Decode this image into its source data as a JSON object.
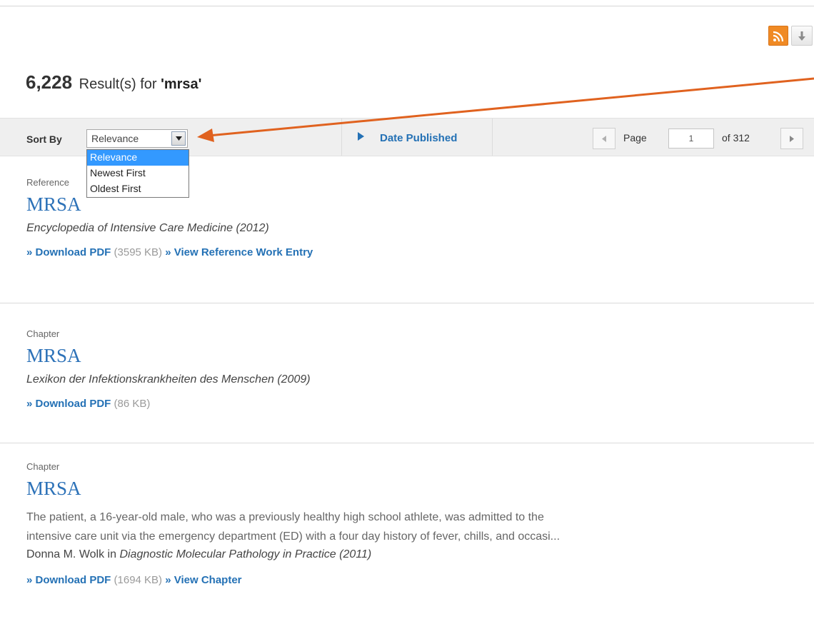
{
  "header": {
    "rss_icon": "rss-icon",
    "download_icon": "download-arrow-icon"
  },
  "results_summary": {
    "count": "6,228",
    "label": "Result(s) for",
    "query": "'mrsa'"
  },
  "sortbar": {
    "sort_label": "Sort By",
    "selected": "Relevance",
    "options": [
      "Relevance",
      "Newest First",
      "Oldest First"
    ],
    "date_published": "Date Published",
    "page_label": "Page",
    "current_page": "1",
    "of_pages": "of 312"
  },
  "results": [
    {
      "type": "Reference",
      "title": "MRSA",
      "source": "Encyclopedia of Intensive Care Medicine (2012)",
      "download": "» Download PDF",
      "size": "(3595 KB)",
      "view": "» View Reference Work Entry"
    },
    {
      "type": "Chapter",
      "title": "MRSA",
      "source": "Lexikon der Infektionskrankheiten des Menschen (2009)",
      "download": "» Download PDF",
      "size": "(86 KB)"
    },
    {
      "type": "Chapter",
      "title": "MRSA",
      "snippet_line1": "The patient, a 16-year-old male, who was a previously healthy high school athlete, was admitted to the",
      "snippet_line2": "intensive care unit via the emergency department (ED) with a four day history of fever, chills, and occasi...",
      "author": "Donna M. Wolk",
      "author_in": "in",
      "source": "Diagnostic Molecular Pathology in Practice (2011)",
      "download": "» Download PDF",
      "size": "(1694 KB)",
      "view": "» View Chapter"
    }
  ],
  "colors": {
    "link": "#2471b5",
    "title": "#2d72b8",
    "rss": "#f08a24",
    "callout_arrow": "#e0621f",
    "dropdown_highlight": "#3399ff"
  }
}
